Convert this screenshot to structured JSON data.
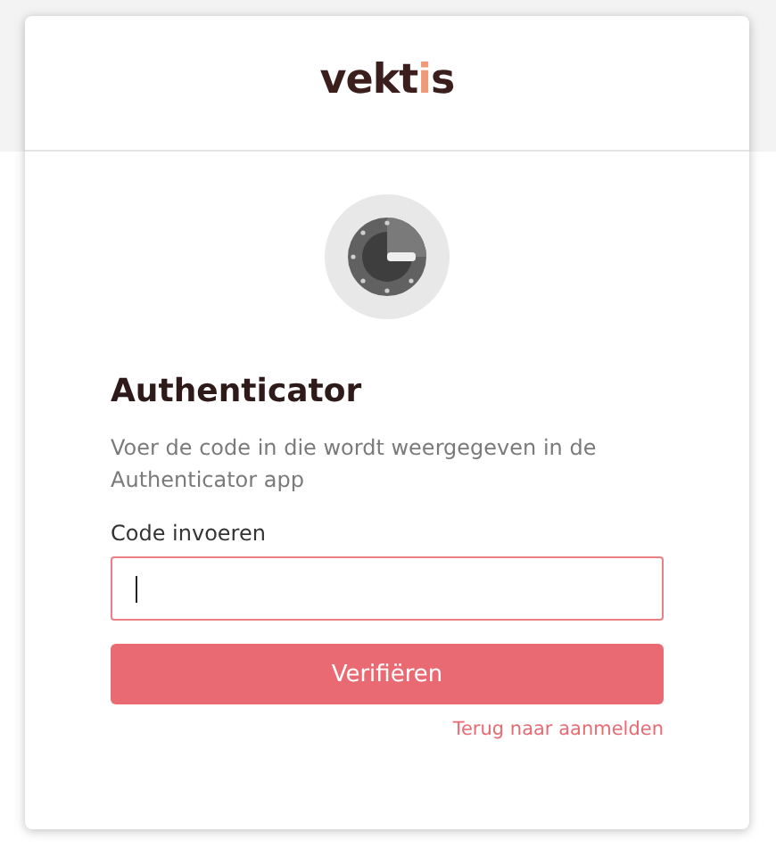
{
  "logo": {
    "parts": [
      {
        "text": "vekt",
        "accent": false
      },
      {
        "text": "i",
        "accent": true
      },
      {
        "text": "s",
        "accent": false
      }
    ]
  },
  "title": "Authenticator",
  "description": "Voer de code in die wordt weergegeven in de Authenticator app",
  "field": {
    "label": "Code invoeren",
    "focused": true
  },
  "button": "Verifiëren",
  "link": "Terug naar aanmelden"
}
